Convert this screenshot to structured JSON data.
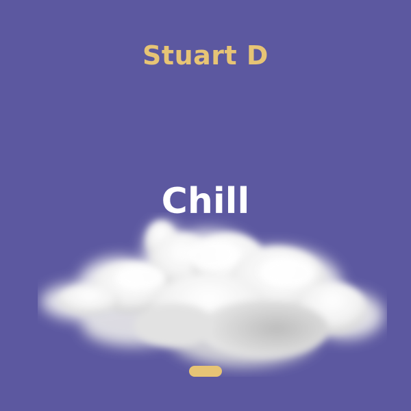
{
  "cover": {
    "artist": "Stuart D",
    "title": "Chill",
    "image": "cloud",
    "indicator": "pill"
  },
  "colors": {
    "background": "#5c58a0",
    "artist_text": "#e7c475",
    "title_text": "#ffffff",
    "indicator": "#e7c475"
  }
}
